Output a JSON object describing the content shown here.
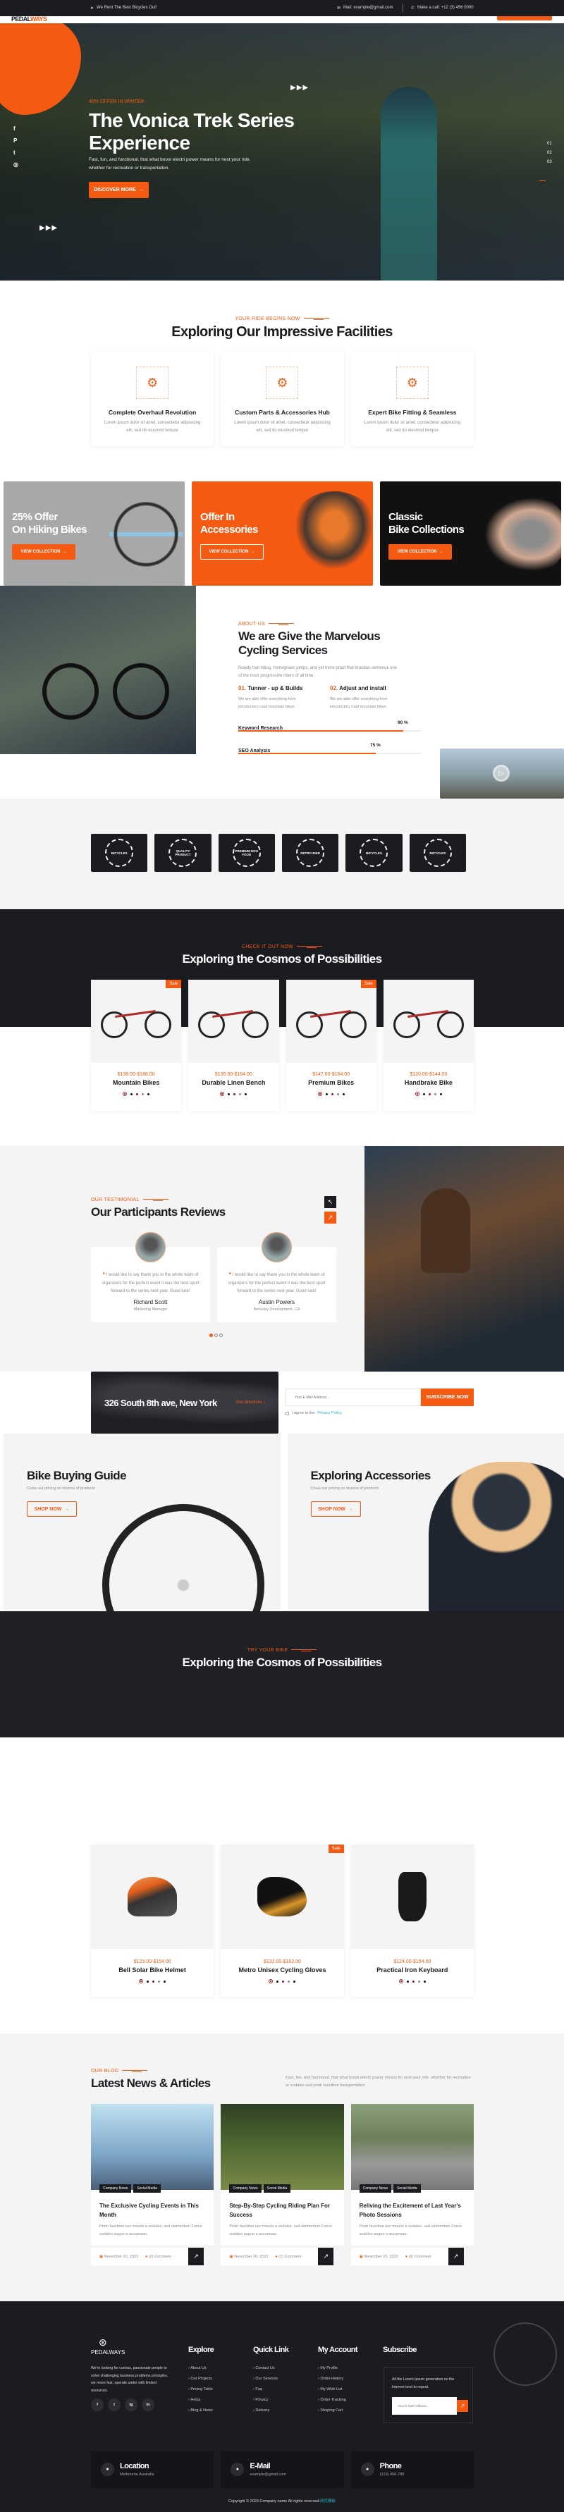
{
  "colors": {
    "accent": "#f55a12",
    "dark": "#1b1c20",
    "light_bg": "#f4f4f4"
  },
  "topbar": {
    "tagline": "We Rent The Best Bicycles Out!",
    "mail": "Mail: example@gmail.com",
    "phone": "Make a call: +12 (3) 456 0000"
  },
  "header": {
    "logo_a": "PEDAL",
    "logo_b": "WAYS"
  },
  "hero": {
    "eyebrow": "40% OFFER IN WINTER",
    "title_1": "The Vonica Trek Series",
    "title_2": "Experience",
    "text_1": "Fast, fun, and functional. that what boost electri power means for nest your ride.",
    "text_2": "whether for recreation or transportation.",
    "button": "DISCOVER MORE",
    "slides": [
      "01",
      "02",
      "03"
    ],
    "active_slide": "03",
    "socials": [
      "facebook-icon",
      "pinterest-icon",
      "twitter-icon",
      "instagram-icon"
    ]
  },
  "facilities": {
    "eyebrow": "YOUR RIDE BEGINS NOW",
    "title": "Exploring Our Impressive Facilities",
    "items": [
      {
        "icon": "handlebar-icon",
        "title": "Complete Overhaul Revolution",
        "text": "Lorem ipsum dolor sit amet, consectetur adipisicing elit, sed do eiusmod tempor"
      },
      {
        "icon": "helmet-icon",
        "title": "Custom Parts & Accessories Hub",
        "text": "Lorem ipsum dolor sit amet, consectetur adipisicing elit, sed do eiusmod tempor"
      },
      {
        "icon": "bike-fitting-icon",
        "title": "Expert Bike Fitting & Seamless",
        "text": "Lorem ipsum dolor sit amet, consectetur adipisicing elit, sed do eiusmod tempor"
      }
    ]
  },
  "offers": [
    {
      "title_1": "25% Offer",
      "title_2": "On Hiking Bikes",
      "button": "VIEW COLLECTION"
    },
    {
      "title_1": "Offer In",
      "title_2": "Accessories",
      "button": "VIEW COLLECTION"
    },
    {
      "title_1": "Classic",
      "title_2": "Bike Collections",
      "button": "VIEW COLLECTION"
    }
  ],
  "about": {
    "eyebrow": "ABOUT US",
    "title_1": "We are Give the Marvelous",
    "title_2": "Cycling Services",
    "text": "Rowdy trail riding, homegrown jumps, and yet more proof that brandon semenuk one of the most progressive riders of all time.",
    "features": [
      {
        "num": "01.",
        "title": "Tunner - up & Builds",
        "text": "We are able offer everything from introductory road mountain bikes"
      },
      {
        "num": "02.",
        "title": "Adjust and install",
        "text": "We are able offer everything from introductory road mountain bikes"
      }
    ],
    "skills": [
      {
        "label": "Keyword Research",
        "value": "90 %",
        "percent": 90
      },
      {
        "label": "SEO Analysis",
        "value": "75 %",
        "percent": 75
      }
    ]
  },
  "brands": [
    "BICYCLES",
    "QUALITY PRODUCT",
    "PREMIUM DOG FOOD",
    "RETRO BIKE",
    "BICYCLES",
    "BICYCLES"
  ],
  "bikes": {
    "eyebrow": "CHECK IT OUT NOW",
    "title": "Exploring the Cosmos of Possibilities",
    "items": [
      {
        "badge": "Sale",
        "price": "$138.00-$188.00",
        "name": "Mountain Bikes"
      },
      {
        "badge": "",
        "price": "$135.00-$164.00",
        "name": "Durable Linen Bench"
      },
      {
        "badge": "Sale",
        "price": "$147.00-$164.00",
        "name": "Premium Bikes"
      },
      {
        "badge": "",
        "price": "$120.00-$144.00",
        "name": "Handbrake Bike"
      }
    ]
  },
  "testimonials": {
    "eyebrow": "OUR TESTIMONIAL",
    "title": "Our Participants Reviews",
    "items": [
      {
        "quote": "I would like to say thank you to the whole team of organizers for the perfect event it was the best sport forward to the series next year. Good luck!",
        "name": "Richard Scott",
        "role": "Marketing Manager"
      },
      {
        "quote": "I would like to say thank you to the whole team of organizers for the perfect event it was the best sport forward to the series next year. Good luck!",
        "name": "Austin Powers",
        "role": "Berkeley Development, CA"
      }
    ],
    "active_page": 1,
    "pages": 3
  },
  "location": {
    "address": "326 South 8th ave, New York",
    "directions": "Get directions"
  },
  "newsletter": {
    "placeholder": "Your E-Mail Address...",
    "button": "SUBSCRIBE NOW",
    "agree": "I agree to the",
    "policy": "Privacy Policy."
  },
  "guides": [
    {
      "title": "Bike Buying Guide",
      "text": "Close-out pricing on dozens of products",
      "button": "SHOP NOW"
    },
    {
      "title": "Exploring Accessories",
      "text": "Close-out pricing on dozens of products",
      "button": "SHOP NOW"
    }
  ],
  "try": {
    "eyebrow": "TRY YOUR BIKE",
    "title": "Exploring the Cosmos of Possibilities"
  },
  "accessories": [
    {
      "badge": "",
      "price": "$123.00-$154.00",
      "name": "Bell Solar Bike Helmet"
    },
    {
      "badge": "Sale",
      "price": "$132.00-$162.00",
      "name": "Metro Unisex Cycling Gloves"
    },
    {
      "badge": "",
      "price": "$124.00-$154.00",
      "name": "Practical Iron Keyboard"
    }
  ],
  "blog": {
    "eyebrow": "OUR BLOG",
    "title": "Latest News & Articles",
    "intro": "Fast, fun, and functional. that what boost electri power means for nest your ride. whether for recreation or sodales sed proin faucibus transportation.",
    "posts": [
      {
        "tag_1": "Company News",
        "tag_2": "Social Media",
        "title": "The Exclusive Cycling Events in This Month",
        "excerpt": "Proin faucibus nec mauris a sodales, sed elementum Fusce sodales augue a accumsan.",
        "date": "November 20, 2023",
        "comments": "(2) Comment"
      },
      {
        "tag_1": "Company News",
        "tag_2": "Social Media",
        "title": "Step-By-Step Cycling Riding Plan For Success",
        "excerpt": "Proin faucibus nec mauris a sodales, sed elementum Fusce sodales augue a accumsan.",
        "date": "November 20, 2023",
        "comments": "(2) Comment"
      },
      {
        "tag_1": "Company News",
        "tag_2": "Social Media",
        "title": "Reliving the Excitement of Last Year's Photo Sessions",
        "excerpt": "Proin faucibus nec mauris a sodales, sed elementum Fusce sodales augue a accumsan.",
        "date": "November 20, 2023",
        "comments": "(2) Comment"
      }
    ]
  },
  "footer": {
    "logo": "PEDALWAYS",
    "about": "We're looking for curious, passionate people to solve challenging business problems principles. we move fast, operate under with limited resources.",
    "socials": [
      "f",
      "t",
      "ig",
      "in"
    ],
    "explore": {
      "title": "Explore",
      "links": [
        "About Us",
        "Our Projects",
        "Pricing Table",
        "Helps",
        "Blog & News"
      ]
    },
    "quick": {
      "title": "Quick Link",
      "links": [
        "Contact Us",
        "Our Services",
        "Faq",
        "Privacy",
        "Delivery"
      ]
    },
    "account": {
      "title": "My Account",
      "links": [
        "My Profile",
        "Order History",
        "My Wish List",
        "Order Tracking",
        "Shoping Cart"
      ]
    },
    "subscribe": {
      "title": "Subscribe",
      "text": "All the Lorem Ipsum generators on the Internet tend to repeat.",
      "placeholder": "Your E-Mail Address..."
    },
    "contacts": [
      {
        "icon": "location-arrow-icon",
        "title": "Location",
        "value": "Melbourne Australia"
      },
      {
        "icon": "envelope-icon",
        "title": "E-Mail",
        "value": "example@gmail.com"
      },
      {
        "icon": "phone-icon",
        "title": "Phone",
        "value": "(123) 456-789"
      }
    ],
    "copyright": "Copyright © 2023.Company name All rights reserved.",
    "copyright_link": "网页模板"
  }
}
